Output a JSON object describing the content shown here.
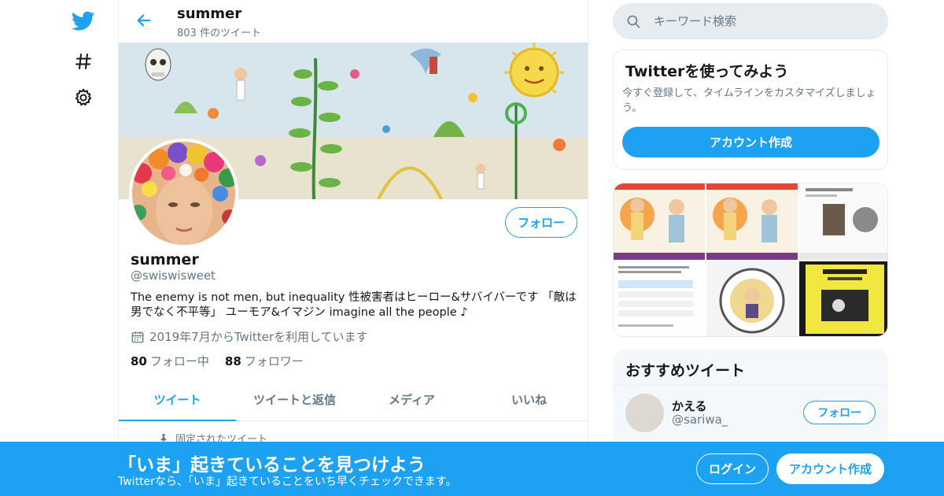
{
  "colors": {
    "accent": "#1da1f2",
    "text": "#14171a",
    "secondary": "#657786",
    "border": "#e6ecf0"
  },
  "header": {
    "name": "summer",
    "tweet_count": "803 件のツイート"
  },
  "profile": {
    "name": "summer",
    "handle": "@swiswisweet",
    "bio": "The enemy is not men,  but inequality 性被害者はヒーロー&サバイバーです 「敵は男でなく不平等」 ユーモア&イマジン imagine all the people ♪",
    "joined": "2019年7月からTwitterを利用しています",
    "following_count": "80",
    "following_label": "フォロー中",
    "followers_count": "88",
    "followers_label": "フォロワー",
    "follow_label": "フォロー"
  },
  "tabs": [
    {
      "label": "ツイート",
      "active": true
    },
    {
      "label": "ツイートと返信",
      "active": false
    },
    {
      "label": "メディア",
      "active": false
    },
    {
      "label": "いいね",
      "active": false
    }
  ],
  "pinned_label": "固定されたツイート",
  "search": {
    "placeholder": "キーワード検索"
  },
  "signup_card": {
    "title": "Twitterを使ってみよう",
    "description": "今すぐ登録して、タイムラインをカスタマイズしましょう。",
    "button": "アカウント作成"
  },
  "recommended": {
    "title": "おすすめツイート",
    "items": [
      {
        "name": "かえる",
        "handle": "@sariwa_",
        "follow_label": "フォロー"
      }
    ]
  },
  "bottom_bar": {
    "title": "「いま」起きていることを見つけよう",
    "subtitle": "Twitterなら、「いま」起きていることをいち早くチェックできます。",
    "login": "ログイン",
    "signup": "アカウント作成"
  },
  "icons": {
    "nav": [
      "twitter-bird-icon",
      "hashtag-icon",
      "gear-icon"
    ],
    "back": "back-arrow-icon",
    "search": "search-icon",
    "calendar": "calendar-icon",
    "pin": "pin-icon"
  }
}
